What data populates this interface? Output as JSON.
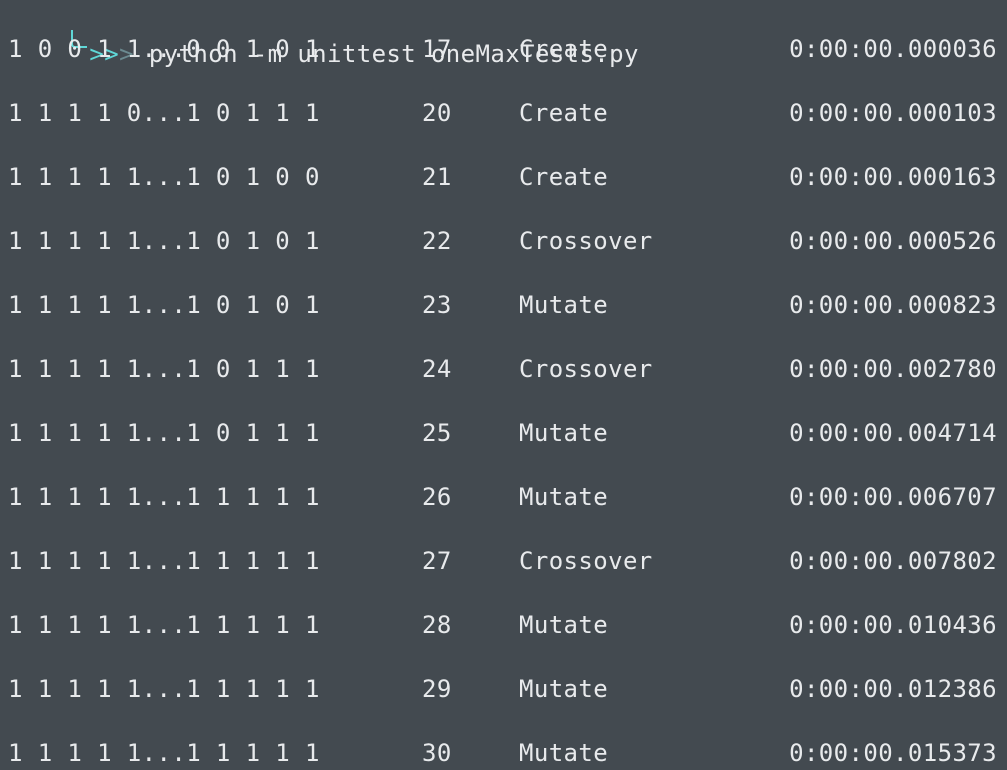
{
  "prompt": {
    "arrows": ">>",
    "arrows_dim": ">",
    "command": "python -m unittest oneMaxTests.py"
  },
  "rows": [
    {
      "genome": "1 0 0 1 1...0 0 1 0 1",
      "fitness": "17",
      "operation": "Create",
      "time": "0:00:00.000036"
    },
    {
      "genome": "1 1 1 1 0...1 0 1 1 1",
      "fitness": "20",
      "operation": "Create",
      "time": "0:00:00.000103"
    },
    {
      "genome": "1 1 1 1 1...1 0 1 0 0",
      "fitness": "21",
      "operation": "Create",
      "time": "0:00:00.000163"
    },
    {
      "genome": "1 1 1 1 1...1 0 1 0 1",
      "fitness": "22",
      "operation": "Crossover",
      "time": "0:00:00.000526"
    },
    {
      "genome": "1 1 1 1 1...1 0 1 0 1",
      "fitness": "23",
      "operation": "Mutate",
      "time": "0:00:00.000823"
    },
    {
      "genome": "1 1 1 1 1...1 0 1 1 1",
      "fitness": "24",
      "operation": "Crossover",
      "time": "0:00:00.002780"
    },
    {
      "genome": "1 1 1 1 1...1 0 1 1 1",
      "fitness": "25",
      "operation": "Mutate",
      "time": "0:00:00.004714"
    },
    {
      "genome": "1 1 1 1 1...1 1 1 1 1",
      "fitness": "26",
      "operation": "Mutate",
      "time": "0:00:00.006707"
    },
    {
      "genome": "1 1 1 1 1...1 1 1 1 1",
      "fitness": "27",
      "operation": "Crossover",
      "time": "0:00:00.007802"
    },
    {
      "genome": "1 1 1 1 1...1 1 1 1 1",
      "fitness": "28",
      "operation": "Mutate",
      "time": "0:00:00.010436"
    },
    {
      "genome": "1 1 1 1 1...1 1 1 1 1",
      "fitness": "29",
      "operation": "Mutate",
      "time": "0:00:00.012386"
    },
    {
      "genome": "1 1 1 1 1...1 1 1 1 1",
      "fitness": "30",
      "operation": "Mutate",
      "time": "0:00:00.015373"
    }
  ]
}
